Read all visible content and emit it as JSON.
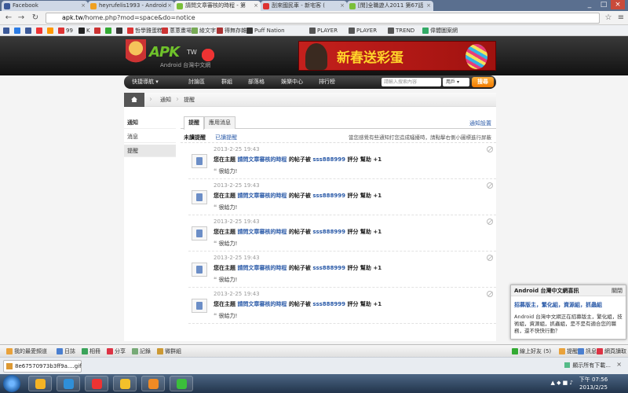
{
  "browser": {
    "tabs": [
      {
        "label": "Facebook",
        "color": "#3b5998"
      },
      {
        "label": "heyrufelis1993 - Android",
        "color": "#f0a020"
      },
      {
        "label": "請問文章審核的時程 - 第",
        "color": "#7bbf3a"
      },
      {
        "label": "刮來國民車 - 新宅客 (",
        "color": "#d33"
      },
      {
        "label": "[閒]全職遊人2011 第67話",
        "color": "#7bbf3a"
      }
    ],
    "window_controls": [
      "_",
      "□",
      "×"
    ],
    "address": {
      "host": "apk.tw",
      "path": "/home.php?mod=space&do=notice"
    },
    "bookmarks": [
      {
        "label": "",
        "color": "#3b5998"
      },
      {
        "label": "",
        "color": "#2a7be4"
      },
      {
        "label": "",
        "color": "#3b5998"
      },
      {
        "label": "",
        "color": "#e33"
      },
      {
        "label": "",
        "color": "#f90"
      },
      {
        "label": "99",
        "color": "#d33"
      },
      {
        "label": "K",
        "color": "#222"
      },
      {
        "label": "",
        "color": "#c33"
      },
      {
        "label": "",
        "color": "#3a3"
      },
      {
        "label": "",
        "color": "#333"
      },
      {
        "label": "哲學雞蛋糕",
        "color": "#d33"
      },
      {
        "label": "蔥蔥畫場",
        "color": "#c33"
      },
      {
        "label": "綾文字",
        "color": "#7a5"
      },
      {
        "label": "得無存雜",
        "color": "#a33"
      },
      {
        "label": "Puff Nation",
        "color": "#333"
      },
      {
        "label": "PLAYER",
        "color": "#555"
      },
      {
        "label": "PLAYER",
        "color": "#555"
      },
      {
        "label": "TREND",
        "color": "#555"
      },
      {
        "label": "偉體圖案網",
        "color": "#3a6"
      }
    ]
  },
  "site": {
    "logo": {
      "brand": "APK",
      "suffix": "TW",
      "sub": "Android 台灣中文網"
    },
    "banner": {
      "title": "新春送彩蛋"
    },
    "nav": {
      "quick_nav": "快捷導航",
      "items": [
        "討論區",
        "群組",
        "部落格",
        "娛樂中心",
        "排行榜"
      ],
      "search_placeholder": "請輸入搜索內容",
      "search_scope": "用戶",
      "search_button": "搜尋"
    },
    "breadcrumb": [
      "通知",
      "提醒"
    ],
    "sidebar": [
      "通知",
      "消息",
      "提醒"
    ],
    "tabs": [
      "提醒",
      "應用消息"
    ],
    "settings_link": "通知設置",
    "filter": {
      "unread": "未讀提醒",
      "read": "已讀提醒",
      "tip": "當您感覺有些通知打您造成騷擾時，請點擊右側小圖標進行屏蔽"
    },
    "notices": [
      {
        "date": "2013-2-25 19:43",
        "prefix": "您在主題",
        "topic": "請問文章審核的時程",
        "mid": "的帖子被",
        "user": "sss888999",
        "suffix": "評分 幫助 +1",
        "quote": "很給力!"
      },
      {
        "date": "2013-2-25 19:43",
        "prefix": "您在主題",
        "topic": "請問文章審核的時程",
        "mid": "的帖子被",
        "user": "sss888999",
        "suffix": "評分 幫助 +1",
        "quote": "很給力!"
      },
      {
        "date": "2013-2-25 19:43",
        "prefix": "您在主題",
        "topic": "請問文章審核的時程",
        "mid": "的帖子被",
        "user": "sss888999",
        "suffix": "評分 幫助 +1",
        "quote": "很給力!"
      },
      {
        "date": "2013-2-25 19:43",
        "prefix": "您在主題",
        "topic": "請問文章審核的時程",
        "mid": "的帖子被",
        "user": "sss888999",
        "suffix": "評分 幫助 +1",
        "quote": "很給力!"
      },
      {
        "date": "2013-2-25 19:43",
        "prefix": "您在主題",
        "topic": "請問文章審核的時程",
        "mid": "的帖子被",
        "user": "sss888999",
        "suffix": "評分 幫助 +1",
        "quote": "很給力!"
      }
    ],
    "toast": {
      "header": "Android 台灣中文網喜訊",
      "close": "關閉",
      "title": "招募版主，繁化組，資源組，抓蟲組",
      "body": "Android 台灣中文網正在招募版主，繁化組，技術組，資源組，抓蟲組，是不是有適合您的職務，還不快快行動？"
    },
    "bottom_bar": {
      "left": [
        {
          "label": "我的最愛頻道",
          "color": "#e9a23b"
        },
        {
          "label": "日誌",
          "color": "#4a7fd0"
        },
        {
          "label": "相冊",
          "color": "#3aa35a"
        },
        {
          "label": "分享",
          "color": "#d34"
        },
        {
          "label": "記錄",
          "color": "#7a7"
        },
        {
          "label": "微群組",
          "color": "#c93"
        }
      ],
      "right": [
        {
          "label": "線上好友 (5)",
          "color": "#3a3"
        },
        {
          "label": "提醒",
          "color": "#e9a23b"
        },
        {
          "label": "訊息",
          "color": "#4a7fd0"
        },
        {
          "label": "網頁讀取",
          "color": "#d34"
        }
      ]
    }
  },
  "downloads": {
    "file": "8e67570973b3ff9a....gif",
    "show_all": "顯示所有下載...",
    "close": "×"
  },
  "taskbar": {
    "apps": [
      {
        "color": "#f4b324"
      },
      {
        "color": "#2f8fd8"
      },
      {
        "color": "#e33"
      },
      {
        "color": "#f3c12a"
      },
      {
        "color": "#f08a24"
      },
      {
        "color": "#3bbf3b"
      }
    ],
    "tray": "▲ ◆ ■ ♪",
    "time": "下午 07:56",
    "date": "2013/2/25"
  }
}
